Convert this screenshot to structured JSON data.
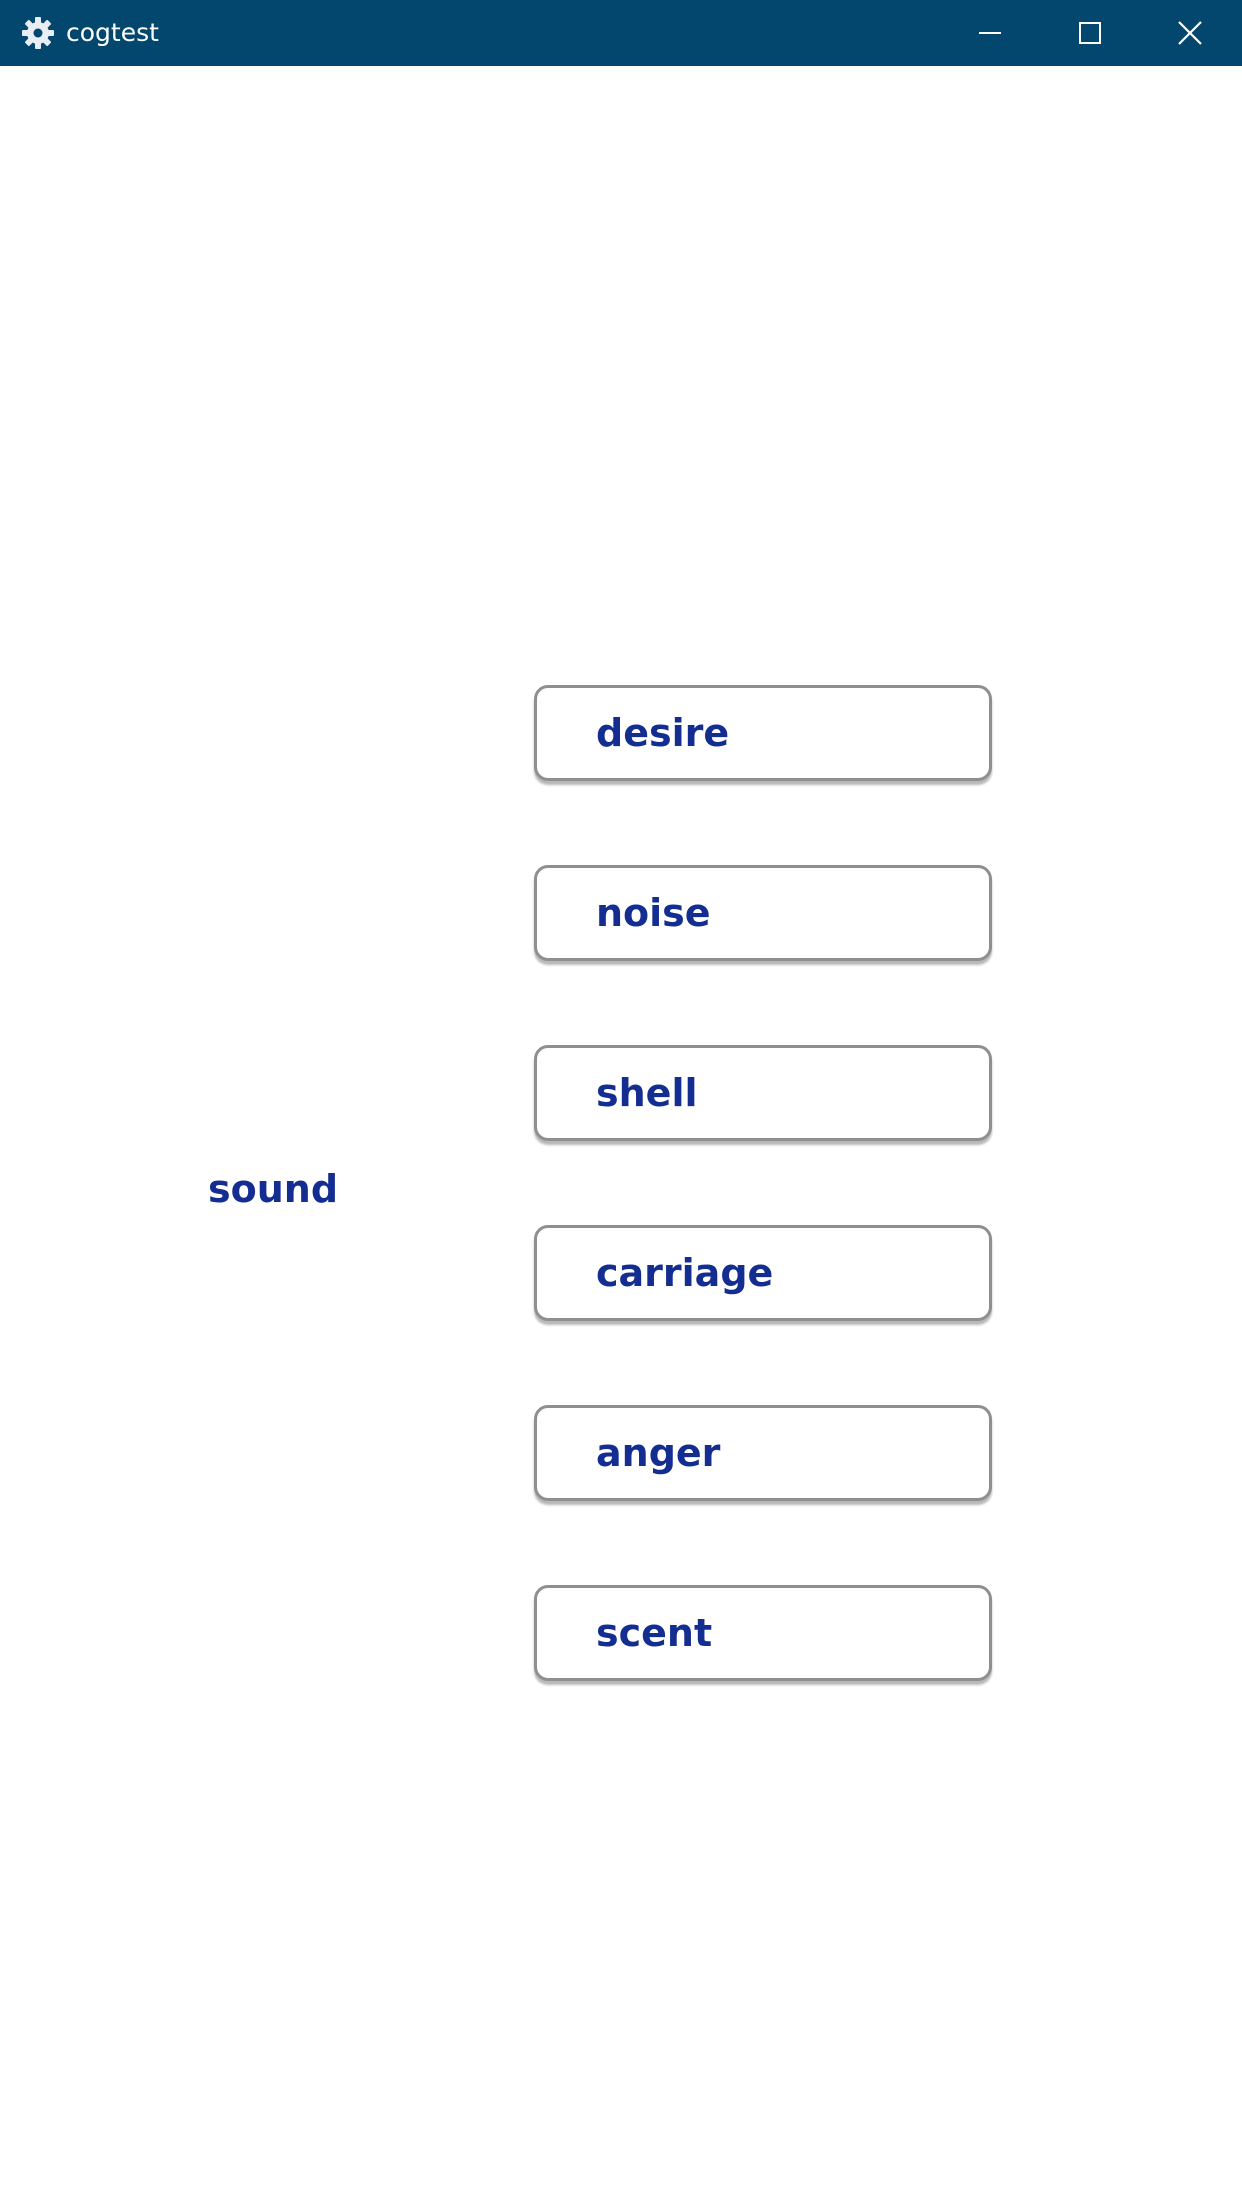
{
  "window": {
    "title": "cogtest",
    "icon": "gear-icon",
    "controls": {
      "minimize_icon": "minimize-icon",
      "maximize_icon": "maximize-icon",
      "close_icon": "close-icon"
    }
  },
  "task": {
    "prompt_word": "sound",
    "choices": [
      {
        "label": "desire"
      },
      {
        "label": "noise"
      },
      {
        "label": "shell"
      },
      {
        "label": "carriage"
      },
      {
        "label": "anger"
      },
      {
        "label": "scent"
      }
    ]
  },
  "colors": {
    "titlebar": "#03466e",
    "text": "#132d91",
    "button_border": "#8f8f8f",
    "background": "#ffffff"
  }
}
